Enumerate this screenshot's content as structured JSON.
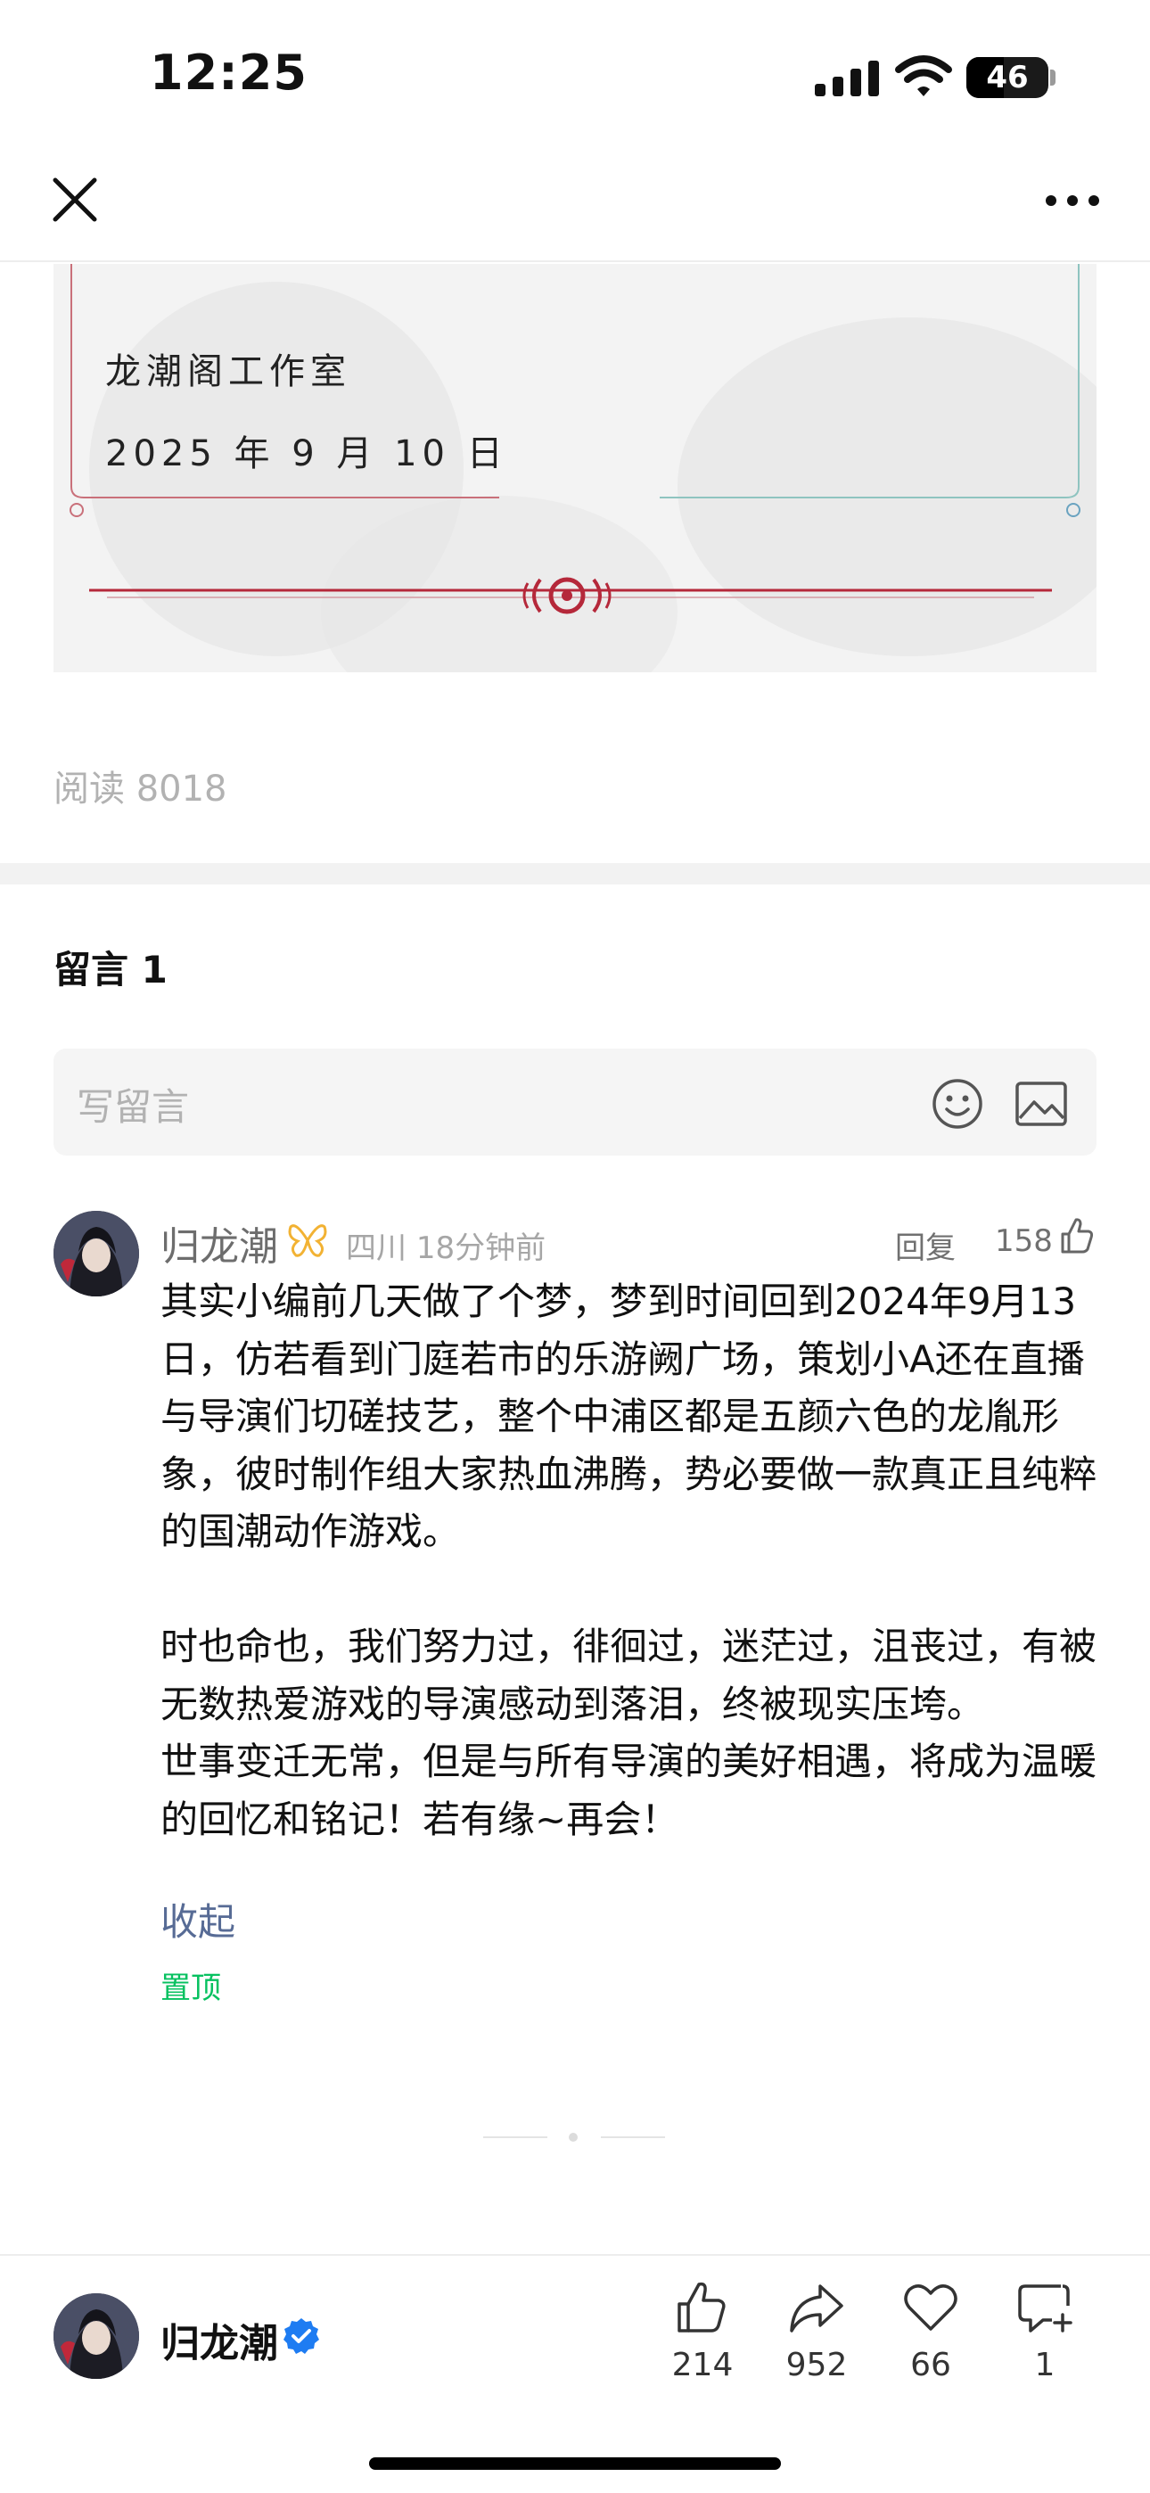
{
  "status_bar": {
    "time": "12:25",
    "battery": "46",
    "battery_level": 0.46
  },
  "nav": {
    "close_icon": "close-icon",
    "more_icon": "more-icon"
  },
  "article": {
    "studio_name": "龙潮阁工作室",
    "date": "2025 年 9 月 10 日",
    "read_count": "阅读 8018"
  },
  "comments": {
    "heading": "留言 1",
    "write_placeholder": "写留言",
    "items": [
      {
        "author": "归龙潮",
        "location": "四川",
        "time": "18分钟前",
        "reply_label": "回复",
        "likes": "158",
        "body": "其实小编前几天做了个梦，梦到时间回到2024年9月13日，仿若看到门庭若市的乐游阙广场，策划小A还在直播与导演们切磋技艺，整个中浦区都是五颜六色的龙胤形象，彼时制作组大家热血沸腾，势必要做一款真正且纯粹的国潮动作游戏。\n\n时也命也，我们努力过，徘徊过，迷茫过，沮丧过，有被无数热爱游戏的导演感动到落泪，终被现实压垮。\n世事变迁无常，但是与所有导演的美好相遇，将成为温暖的回忆和铭记！若有缘~再会！",
        "collapse_label": "收起",
        "pinned_label": "置顶"
      }
    ]
  },
  "bottom_bar": {
    "author": "归龙潮",
    "actions": [
      {
        "icon": "thumbs-up-icon",
        "count": "214"
      },
      {
        "icon": "share-icon",
        "count": "952"
      },
      {
        "icon": "heart-icon",
        "count": "66"
      },
      {
        "icon": "comment-add-icon",
        "count": "1"
      }
    ]
  },
  "colors": {
    "link": "#576b95",
    "pinned": "#07c160",
    "accent_red": "#b5283a",
    "accent_teal": "#8fc4c0",
    "verified": "#1e7cf2"
  }
}
